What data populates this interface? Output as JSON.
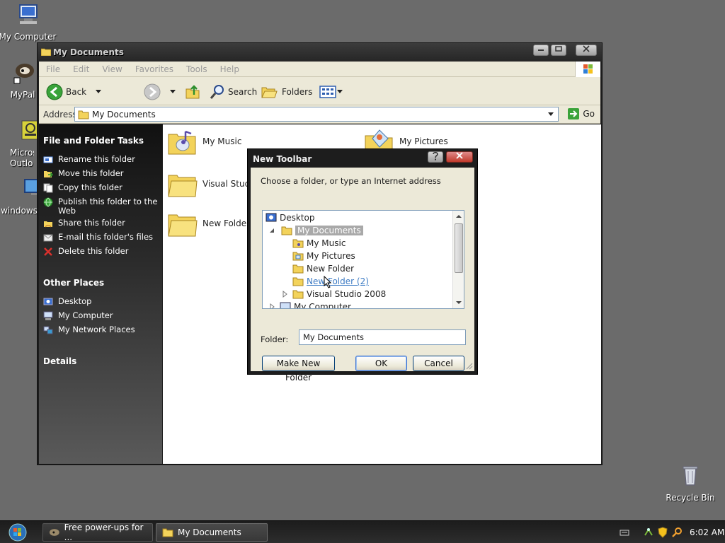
{
  "desktop": {
    "icons": [
      {
        "label": "My Computer"
      },
      {
        "label": "MyPal"
      },
      {
        "label": "Micros Outlo"
      },
      {
        "label": "windows"
      },
      {
        "label": "Recycle Bin"
      }
    ]
  },
  "explorer": {
    "title": "My Documents",
    "menu": [
      "File",
      "Edit",
      "View",
      "Favorites",
      "Tools",
      "Help"
    ],
    "toolbar": {
      "back": "Back",
      "search": "Search",
      "folders": "Folders"
    },
    "address": {
      "label": "Address",
      "value": "My Documents",
      "go": "Go"
    },
    "taskpane": {
      "tasks_heading": "File and Folder Tasks",
      "tasks": [
        {
          "label": "Rename this folder",
          "icon": "rename-icon"
        },
        {
          "label": "Move this folder",
          "icon": "move-icon"
        },
        {
          "label": "Copy this folder",
          "icon": "copy-icon"
        },
        {
          "label": "Publish this folder to the Web",
          "icon": "globe-icon"
        },
        {
          "label": "Share this folder",
          "icon": "share-icon"
        },
        {
          "label": "E-mail this folder's files",
          "icon": "email-icon"
        },
        {
          "label": "Delete this folder",
          "icon": "delete-icon"
        }
      ],
      "places_heading": "Other Places",
      "places": [
        {
          "label": "Desktop",
          "icon": "desktop-icon"
        },
        {
          "label": "My Computer",
          "icon": "computer-icon"
        },
        {
          "label": "My Network Places",
          "icon": "network-icon"
        }
      ],
      "details_heading": "Details"
    },
    "files": [
      {
        "label": "My Music"
      },
      {
        "label": "My Pictures"
      },
      {
        "label": "Visual Studi"
      },
      {
        "label": "New Folder"
      }
    ]
  },
  "dialog": {
    "title": "New Toolbar",
    "instruction": "Choose a folder, or type an Internet address",
    "tree": [
      {
        "label": "Desktop"
      },
      {
        "label": "My Documents"
      },
      {
        "label": "My Music"
      },
      {
        "label": "My Pictures"
      },
      {
        "label": "New Folder"
      },
      {
        "label": "New Folder (2)"
      },
      {
        "label": "Visual Studio 2008"
      },
      {
        "label": "My Computer"
      }
    ],
    "folder_label": "Folder:",
    "folder_value": "My Documents",
    "make_new_folder": "Make New Folder",
    "ok": "OK",
    "cancel": "Cancel"
  },
  "taskbar": {
    "tasks": [
      {
        "label": "Free power-ups for ..."
      },
      {
        "label": "My Documents"
      }
    ],
    "clock": "6:02 AM"
  },
  "colors": {
    "selection": "#a9a9a9",
    "link": "#3d7bc4",
    "taskbar": "#222222"
  }
}
